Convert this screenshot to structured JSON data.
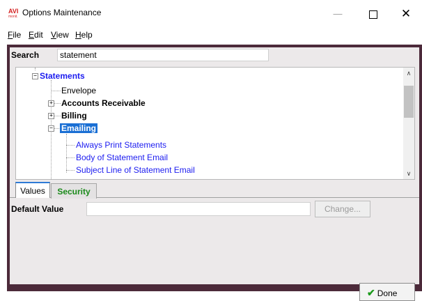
{
  "window": {
    "logo_text": "AVI",
    "logo_subtext": "monit.",
    "title": "Options Maintenance",
    "minimize_glyph": "—",
    "close_glyph": "✕"
  },
  "menu": {
    "file_u": "F",
    "file_rest": "ile",
    "edit_u": "E",
    "edit_rest": "dit",
    "view_u": "V",
    "view_rest": "iew",
    "help_u": "H",
    "help_rest": "elp"
  },
  "search": {
    "label": "Search",
    "value": "statement"
  },
  "tree": {
    "root": "Statements",
    "items": {
      "envelope": "Envelope",
      "accounts_receivable": "Accounts Receivable",
      "billing": "Billing",
      "emailing": "Emailing",
      "always_print": "Always Print Statements",
      "body_email": "Body of Statement Email",
      "subject_line": "Subject Line of Statement Email"
    },
    "expand_minus": "−",
    "expand_plus": "+"
  },
  "tabs": {
    "values": "Values",
    "security": "Security"
  },
  "values_tab": {
    "default_value_label": "Default Value",
    "default_value": "",
    "change_button": "Change..."
  },
  "footer": {
    "done_button": "Done",
    "done_icon": "✔"
  },
  "colors": {
    "frame": "#4c2a3a",
    "link_blue": "#1c1cf0",
    "selection": "#1a6fd4",
    "security_green": "#1a8a1a"
  }
}
